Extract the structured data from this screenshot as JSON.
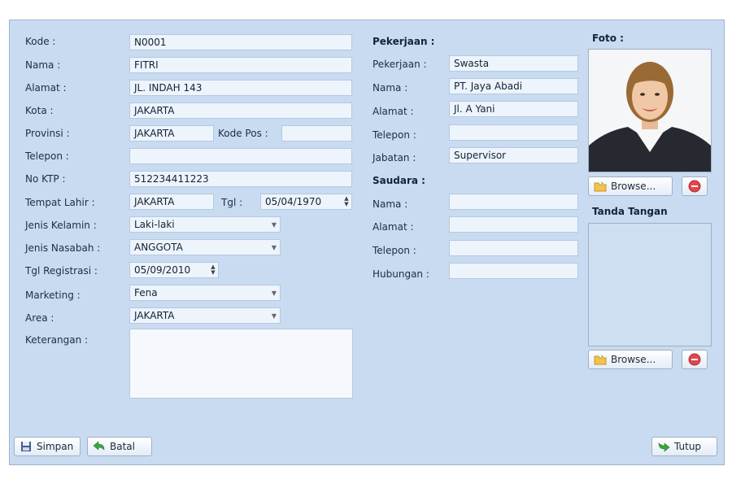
{
  "left": {
    "kode": {
      "label": "Kode :",
      "value": "N0001"
    },
    "nama": {
      "label": "Nama :",
      "value": "FITRI"
    },
    "alamat": {
      "label": "Alamat :",
      "value": "JL. INDAH 143"
    },
    "kota": {
      "label": "Kota :",
      "value": "JAKARTA"
    },
    "provinsi": {
      "label": "Provinsi :",
      "value": "JAKARTA"
    },
    "kodepos": {
      "label": "Kode Pos :",
      "value": ""
    },
    "telepon": {
      "label": "Telepon :",
      "value": ""
    },
    "noktp": {
      "label": "No KTP :",
      "value": "512234411223"
    },
    "tempatlahir": {
      "label": "Tempat Lahir :",
      "value": "JAKARTA"
    },
    "tgl": {
      "label": "Tgl :",
      "value": "05/04/1970"
    },
    "jeniskelamin": {
      "label": "Jenis Kelamin :",
      "value": "Laki-laki"
    },
    "jenisnasabah": {
      "label": "Jenis Nasabah :",
      "value": "ANGGOTA"
    },
    "tglregistrasi": {
      "label": "Tgl Registrasi :",
      "value": "05/09/2010"
    },
    "marketing": {
      "label": "Marketing :",
      "value": "Fena"
    },
    "area": {
      "label": "Area :",
      "value": "JAKARTA"
    },
    "keterangan": {
      "label": "Keterangan :",
      "value": ""
    }
  },
  "pekerjaan": {
    "heading": "Pekerjaan :",
    "pekerjaan": {
      "label": "Pekerjaan :",
      "value": "Swasta"
    },
    "nama": {
      "label": "Nama :",
      "value": "PT. Jaya Abadi"
    },
    "alamat": {
      "label": "Alamat :",
      "value": "Jl. A Yani"
    },
    "telepon": {
      "label": "Telepon :",
      "value": ""
    },
    "jabatan": {
      "label": "Jabatan :",
      "value": "Supervisor"
    }
  },
  "saudara": {
    "heading": "Saudara :",
    "nama": {
      "label": "Nama :",
      "value": ""
    },
    "alamat": {
      "label": "Alamat :",
      "value": ""
    },
    "telepon": {
      "label": "Telepon :",
      "value": ""
    },
    "hubungan": {
      "label": "Hubungan :",
      "value": ""
    }
  },
  "foto": {
    "heading": "Foto :",
    "browse_label": "Browse..."
  },
  "tanda_tangan": {
    "heading": "Tanda Tangan",
    "browse_label": "Browse..."
  },
  "buttons": {
    "simpan": "Simpan",
    "batal": "Batal",
    "tutup": "Tutup"
  },
  "icons": {
    "save": "floppy-disk-icon",
    "cancel": "undo-arrow-icon",
    "close": "exit-arrow-icon",
    "folder": "folder-icon",
    "remove": "remove-circle-icon"
  },
  "colors": {
    "panel": "#c9dbf1",
    "field": "#edf4fc",
    "remove": "#e0474c",
    "green": "#3aa540"
  }
}
